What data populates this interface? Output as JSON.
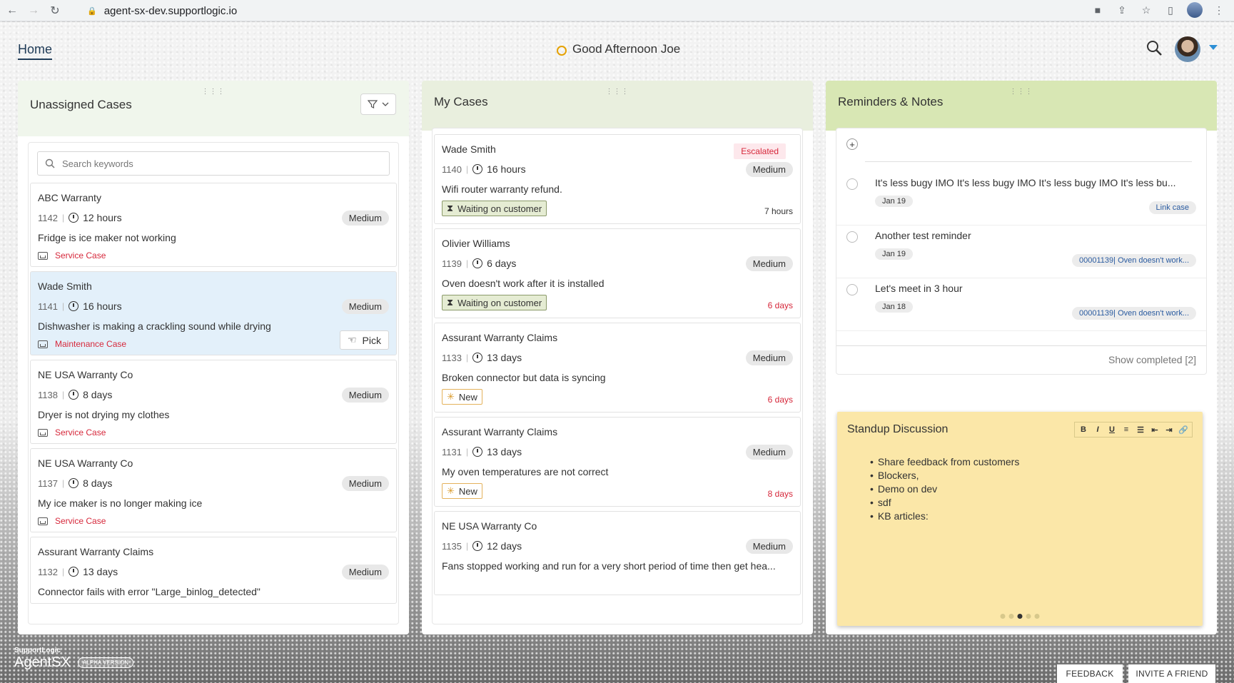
{
  "browser": {
    "url": "agent-sx-dev.supportlogic.io"
  },
  "header": {
    "home_tab": "Home",
    "greeting": "Good Afternoon Joe"
  },
  "columns": {
    "unassigned": {
      "title": "Unassigned Cases",
      "search_placeholder": "Search keywords"
    },
    "my_cases": {
      "title": "My Cases"
    },
    "reminders": {
      "title": "Reminders & Notes"
    }
  },
  "unassigned_cases": [
    {
      "name": "ABC Warranty",
      "number": "1142",
      "time": "12 hours",
      "priority": "Medium",
      "description": "Fridge is ice maker not working",
      "type": "Service Case"
    },
    {
      "name": "Wade Smith",
      "number": "1141",
      "time": "16 hours",
      "priority": "Medium",
      "description": "Dishwasher is making a crackling sound while drying",
      "type": "Maintenance Case",
      "action": "Pick"
    },
    {
      "name": "NE USA Warranty Co",
      "number": "1138",
      "time": "8 days",
      "priority": "Medium",
      "description": "Dryer is not drying my clothes",
      "type": "Service Case"
    },
    {
      "name": "NE USA Warranty Co",
      "number": "1137",
      "time": "8 days",
      "priority": "Medium",
      "description": "My ice maker is no longer making ice",
      "type": "Service Case"
    },
    {
      "name": "Assurant Warranty Claims",
      "number": "1132",
      "time": "13 days",
      "priority": "Medium",
      "description": "Connector fails with error \"Large_binlog_detected\""
    }
  ],
  "my_cases": [
    {
      "name": "Wade Smith",
      "tag": "Escalated",
      "number": "1140",
      "time": "16 hours",
      "priority": "Medium",
      "description": "Wifi router warranty refund.",
      "status": "Waiting on customer",
      "age": "7 hours"
    },
    {
      "name": "Olivier Williams",
      "number": "1139",
      "time": "6 days",
      "priority": "Medium",
      "description": "Oven doesn't work after it is installed",
      "status": "Waiting on customer",
      "age": "6 days"
    },
    {
      "name": "Assurant Warranty Claims",
      "number": "1133",
      "time": "13 days",
      "priority": "Medium",
      "description": "Broken connector but data is syncing",
      "status": "New",
      "age": "6 days"
    },
    {
      "name": "Assurant Warranty Claims",
      "number": "1131",
      "time": "13 days",
      "priority": "Medium",
      "description": "My oven temperatures are not correct",
      "status": "New",
      "age": "8 days"
    },
    {
      "name": "NE USA Warranty Co",
      "number": "1135",
      "time": "12 days",
      "priority": "Medium",
      "description": "Fans stopped working and run for a very short period of time then get hea..."
    }
  ],
  "reminders": [
    {
      "text": "It's less bugy IMO It's less bugy IMO It's less bugy IMO It's less bu...",
      "date": "Jan 19",
      "link": "Link case"
    },
    {
      "text": "Another test reminder",
      "date": "Jan 19",
      "link": "00001139| Oven doesn't work..."
    },
    {
      "text": "Let's meet in 3 hour",
      "date": "Jan 18",
      "link": "00001139| Oven doesn't work..."
    }
  ],
  "show_completed": "Show completed [2]",
  "sticky": {
    "title": "Standup Discussion",
    "items": [
      "Share feedback from customers",
      "Blockers,",
      "Demo on dev",
      "sdf",
      "KB articles:"
    ],
    "toolbar": [
      "B",
      "I",
      "U",
      "≡",
      "☰",
      "⇤",
      "⇥",
      "🔗"
    ]
  },
  "footer": {
    "brand_small": "SupportLogic",
    "brand_big": "AgentSX",
    "alpha": "ALPHA VERSION",
    "feedback": "FEEDBACK",
    "invite": "INVITE A FRIEND"
  }
}
